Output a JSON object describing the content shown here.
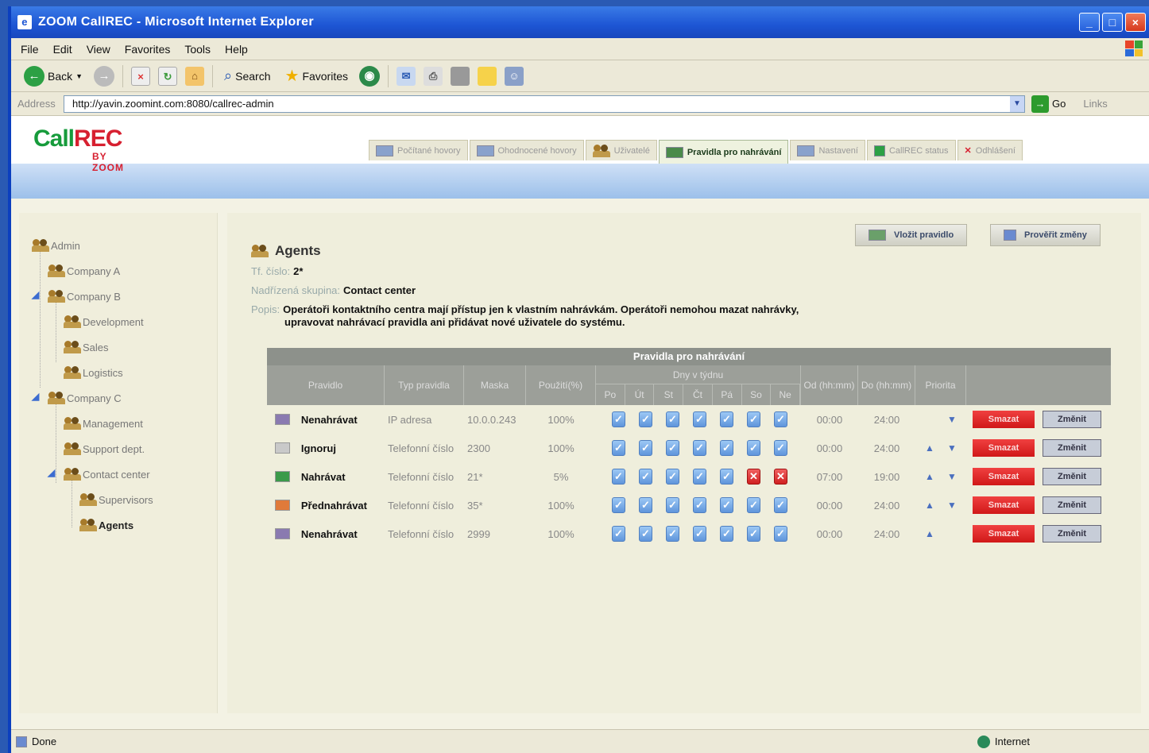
{
  "window": {
    "title": "ZOOM CallREC - Microsoft Internet Explorer"
  },
  "menu": [
    "File",
    "Edit",
    "View",
    "Favorites",
    "Tools",
    "Help"
  ],
  "toolbar": {
    "back": "Back",
    "search": "Search",
    "favorites": "Favorites"
  },
  "address": {
    "label": "Address",
    "url": "http://yavin.zoomint.com:8080/callrec-admin",
    "go": "Go",
    "links": "Links"
  },
  "app": {
    "logo": "CallREC",
    "logo_sub": "BY ZOOM",
    "tabs": [
      "Počítané hovory",
      "Ohodnocené hovory",
      "Uživatelé",
      "Pravidla pro nahrávání",
      "Nastavení",
      "CallREC status",
      "Odhlášení"
    ],
    "active_tab_index": 3
  },
  "tree": [
    {
      "label": "Admin",
      "level": 0
    },
    {
      "label": "Company A",
      "level": 1
    },
    {
      "label": "Company B",
      "level": 1
    },
    {
      "label": "Development",
      "level": 2
    },
    {
      "label": "Sales",
      "level": 2
    },
    {
      "label": "Logistics",
      "level": 2
    },
    {
      "label": "Company C",
      "level": 1
    },
    {
      "label": "Management",
      "level": 2
    },
    {
      "label": "Support dept.",
      "level": 2
    },
    {
      "label": "Contact center",
      "level": 2
    },
    {
      "label": "Supervisors",
      "level": 3
    },
    {
      "label": "Agents",
      "level": 3,
      "active": true
    }
  ],
  "actions": {
    "add_rule": "Vložit pravidlo",
    "check_rules": "Prověřit změny"
  },
  "group": {
    "name": "Agents",
    "phone_label": "Tf. číslo:",
    "phone": "2*",
    "parent_label": "Nadřízená skupina:",
    "parent": "Contact center",
    "desc_label": "Popis:",
    "desc_line1": "Operátoři kontaktního centra mají přístup jen k vlastním nahrávkám. Operátoři nemohou mazat nahrávky,",
    "desc_line2": "upravovat nahrávací pravidla ani přidávat nové uživatele do systému."
  },
  "table": {
    "caption": "Pravidla pro nahrávání",
    "headers": {
      "rule": "Pravidlo",
      "type": "Typ pravidla",
      "mask": "Maska",
      "used": "Použití(%)",
      "days": "Dny v týdnu",
      "from": "Od (hh:mm)",
      "to": "Do (hh:mm)",
      "priority": "Priorita"
    },
    "day_names": [
      "Po",
      "Út",
      "St",
      "Čt",
      "Pá",
      "So",
      "Ne"
    ],
    "rows": [
      {
        "rule": "Nenahrávat",
        "type": "IP adresa",
        "mask": "10.0.0.243",
        "used": "100%",
        "days": [
          true,
          true,
          true,
          true,
          true,
          true,
          true
        ],
        "from": "00:00",
        "to": "24:00",
        "up": false,
        "down": true,
        "icon": "#8a7ab0",
        "delete": "Smazat",
        "change": "Změnit"
      },
      {
        "rule": "Ignoruj",
        "type": "Telefonní číslo",
        "mask": "2300",
        "used": "100%",
        "days": [
          true,
          true,
          true,
          true,
          true,
          true,
          true
        ],
        "from": "00:00",
        "to": "24:00",
        "up": true,
        "down": true,
        "icon": "#c9c9c9",
        "delete": "Smazat",
        "change": "Změnit"
      },
      {
        "rule": "Nahrávat",
        "type": "Telefonní číslo",
        "mask": "21*",
        "used": "5%",
        "days": [
          true,
          true,
          true,
          true,
          true,
          false,
          false
        ],
        "from": "07:00",
        "to": "19:00",
        "up": true,
        "down": true,
        "icon": "#3b9a4a",
        "delete": "Smazat",
        "change": "Změnit"
      },
      {
        "rule": "Přednahrávat",
        "type": "Telefonní číslo",
        "mask": "35*",
        "used": "100%",
        "days": [
          true,
          true,
          true,
          true,
          true,
          true,
          true
        ],
        "from": "00:00",
        "to": "24:00",
        "up": true,
        "down": true,
        "icon": "#e07a3a",
        "delete": "Smazat",
        "change": "Změnit"
      },
      {
        "rule": "Nenahrávat",
        "type": "Telefonní číslo",
        "mask": "2999",
        "used": "100%",
        "days": [
          true,
          true,
          true,
          true,
          true,
          true,
          true
        ],
        "from": "00:00",
        "to": "24:00",
        "up": true,
        "down": false,
        "icon": "#8a7ab0",
        "delete": "Smazat",
        "change": "Změnit"
      }
    ]
  },
  "status": {
    "left": "Done",
    "zone": "Internet"
  }
}
